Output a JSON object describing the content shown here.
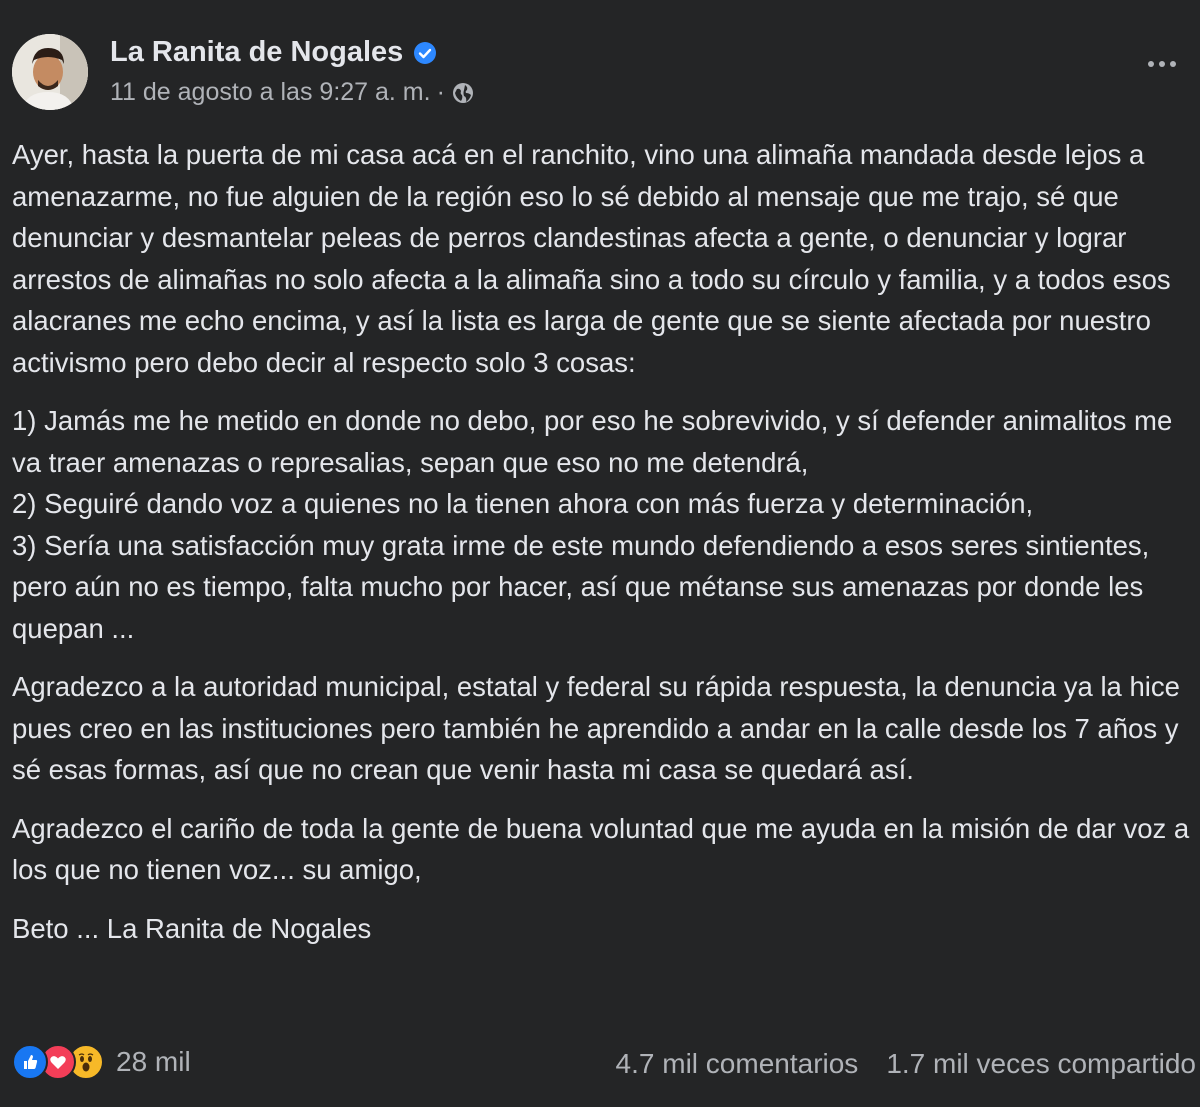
{
  "post": {
    "author": "La Ranita de Nogales",
    "timestamp": "11 de agosto a las 9:27 a. m.",
    "separator": "·",
    "audience_icon": "globe-icon",
    "verified_icon": "verified-badge-icon",
    "paragraphs": [
      "Ayer, hasta la puerta de mi casa acá en el ranchito, vino una alimaña mandada desde lejos a amenazarme, no fue alguien de la región eso lo sé debido al mensaje que me trajo, sé que denunciar y desmantelar peleas de perros clandestinas afecta a gente, o denunciar y lograr arrestos de alimañas no solo afecta a la alimaña sino a todo su círculo y familia, y a todos esos alacranes me echo encima, y así la lista es larga de gente que se siente afectada por nuestro activismo pero debo decir al respecto solo 3 cosas:",
      "1) Jamás me he metido en donde no debo, por eso he sobrevivido, y sí defender animalitos me va traer amenazas o represalias, sepan que eso no me detendrá,",
      "2) Seguiré dando voz a quienes no la tienen ahora con más fuerza y determinación,",
      "3) Sería una satisfacción muy grata irme de este mundo defendiendo a esos seres sintientes, pero aún no es tiempo, falta mucho por hacer, así que métanse sus amenazas por donde les quepan ...",
      "Agradezco a la autoridad municipal, estatal y federal su rápida respuesta, la denuncia ya la hice pues creo en las instituciones pero también he aprendido a andar en la calle desde los 7 años y sé esas formas, así que no crean que venir hasta mi casa se quedará así.",
      "Agradezco el cariño de toda la gente de buena voluntad que me ayuda en la misión de dar voz a los que no tienen voz... su amigo,",
      "Beto ... La Ranita de Nogales"
    ]
  },
  "footer": {
    "reactions": [
      "like-icon",
      "love-icon",
      "wow-icon"
    ],
    "reaction_count": "28 mil",
    "comments": "4.7 mil comentarios",
    "shares": "1.7 mil veces compartido"
  },
  "colors": {
    "background": "#242526",
    "text": "#e4e6eb",
    "secondary_text": "#b0b3b8",
    "verified": "#2d88ff",
    "like": "#1877f2",
    "love": "#f33e58",
    "wow": "#f7b928"
  }
}
